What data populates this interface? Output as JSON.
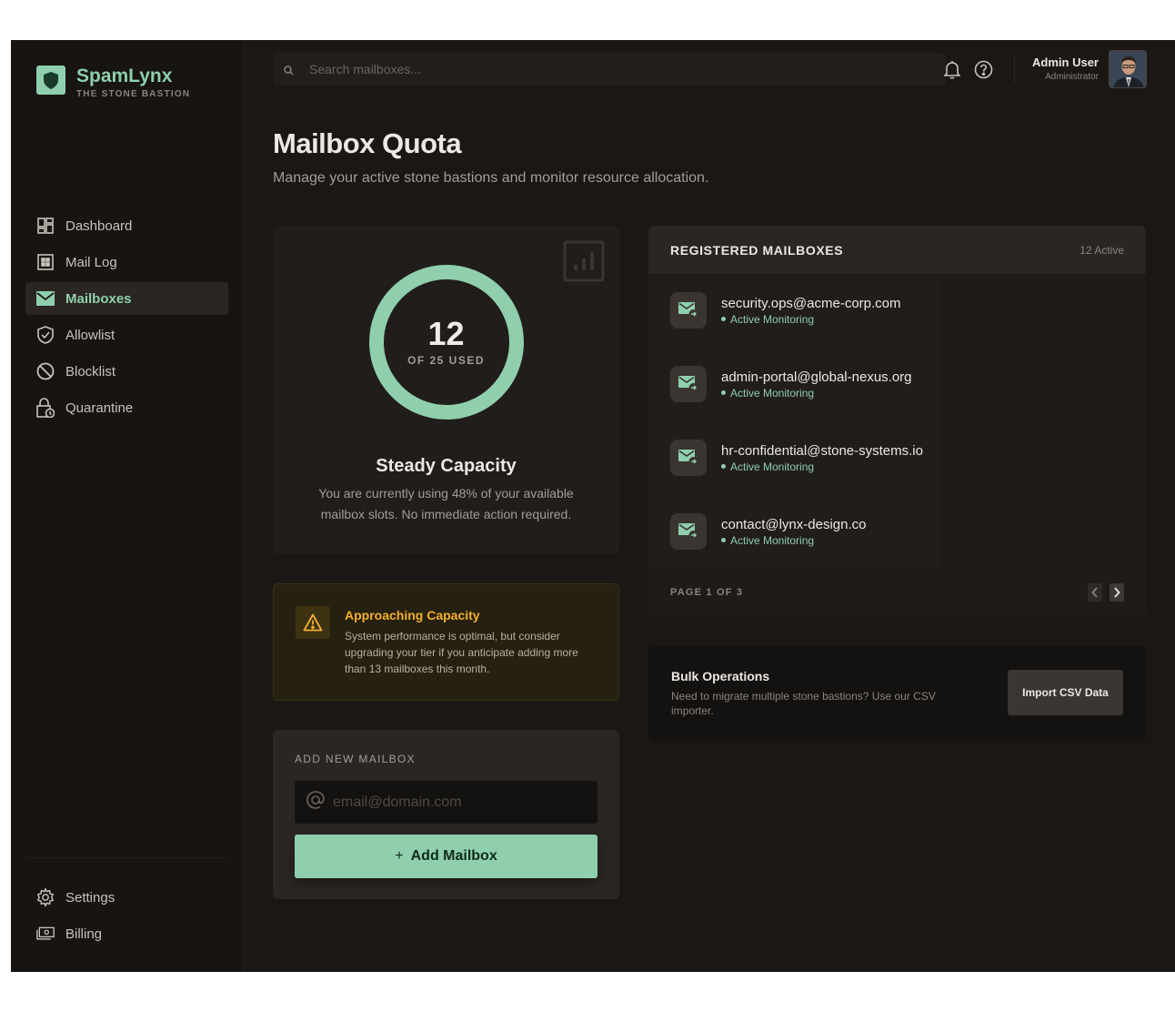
{
  "brand": {
    "name": "SpamLynx",
    "tagline": "THE STONE BASTION"
  },
  "sidebar": {
    "items": [
      {
        "label": "Dashboard",
        "icon": "dashboard-icon"
      },
      {
        "label": "Mail Log",
        "icon": "grid-icon"
      },
      {
        "label": "Mailboxes",
        "icon": "mail-icon",
        "active": true
      },
      {
        "label": "Allowlist",
        "icon": "shield-check-icon"
      },
      {
        "label": "Blocklist",
        "icon": "block-icon"
      },
      {
        "label": "Quarantine",
        "icon": "lock-clock-icon"
      }
    ],
    "bottom": [
      {
        "label": "Settings",
        "icon": "gear-icon"
      },
      {
        "label": "Billing",
        "icon": "billing-icon"
      }
    ]
  },
  "header": {
    "search_placeholder": "Search mailboxes...",
    "user_name": "Admin User",
    "user_role": "Administrator"
  },
  "page": {
    "title": "Mailbox Quota",
    "subtitle": "Manage your active stone bastions and monitor resource allocation."
  },
  "quota": {
    "used": "12",
    "of_label": "OF 25 USED",
    "used_fraction": 0.48,
    "status_title": "Steady Capacity",
    "status_text": "You are currently using 48% of your available mailbox slots. No immediate action required."
  },
  "warning": {
    "title": "Approaching Capacity",
    "text": "System performance is optimal, but consider upgrading your tier if you anticipate adding more than 13 mailboxes this month."
  },
  "add_mailbox": {
    "label": "ADD NEW MAILBOX",
    "placeholder": "email@domain.com",
    "button_label": "Add Mailbox"
  },
  "mailboxes": {
    "title": "REGISTERED MAILBOXES",
    "count": "12 Active",
    "items": [
      {
        "email": "security.ops@acme-corp.com",
        "status": "Active Monitoring"
      },
      {
        "email": "admin-portal@global-nexus.org",
        "status": "Active Monitoring"
      },
      {
        "email": "hr-confidential@stone-systems.io",
        "status": "Active Monitoring"
      },
      {
        "email": "contact@lynx-design.co",
        "status": "Active Monitoring"
      }
    ],
    "page_label": "PAGE 1 OF 3"
  },
  "bulk": {
    "title": "Bulk Operations",
    "text": "Need to migrate multiple stone bastions? Use our CSV importer.",
    "button_label": "Import CSV Data"
  },
  "colors": {
    "accent": "#8fcfad",
    "warning": "#f2b02e",
    "background": "#1a1714"
  }
}
